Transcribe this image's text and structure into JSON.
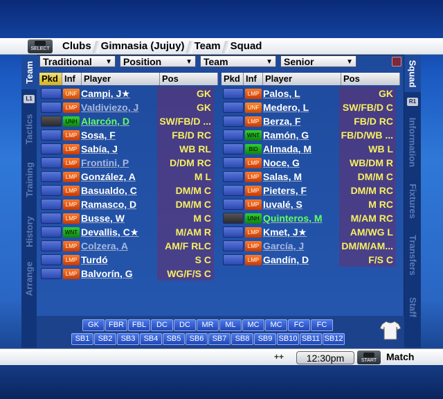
{
  "breadcrumb": {
    "select_label": "SELECT",
    "items": [
      "Clubs",
      "Gimnasia (Jujuy)",
      "Team",
      "Squad"
    ]
  },
  "left_tabs": [
    {
      "label": "Team",
      "active": true
    },
    {
      "label": "Tactics",
      "active": false
    },
    {
      "label": "Training",
      "active": false
    },
    {
      "label": "History",
      "active": false
    },
    {
      "label": "Arrange",
      "active": false
    }
  ],
  "left_tag": "L1",
  "right_tabs": [
    {
      "label": "Squad",
      "active": true
    },
    {
      "label": "Information",
      "active": false
    },
    {
      "label": "Fixtures",
      "active": false
    },
    {
      "label": "Transfers",
      "active": false
    },
    {
      "label": "Staff",
      "active": false
    }
  ],
  "right_tag": "R1",
  "filters": [
    "Traditional",
    "Position",
    "Team",
    "Senior"
  ],
  "columns": {
    "pkd": "Pkd",
    "inf": "Inf",
    "player": "Player",
    "pos": "Pos"
  },
  "left_players": [
    {
      "inf": "UNF",
      "name": "Campi, J★",
      "pos": "GK",
      "style": "normal",
      "pk": "blue"
    },
    {
      "inf": "LMP",
      "name": "Valdiviezo, J",
      "pos": "GK",
      "style": "muted",
      "pk": "blue"
    },
    {
      "inf": "UNH",
      "name": "Alarcón, D",
      "pos": "SW/FB/D ...",
      "style": "green",
      "pk": "dark"
    },
    {
      "inf": "LMP",
      "name": "Sosa, F",
      "pos": "FB/D RC",
      "style": "normal",
      "pk": "blue"
    },
    {
      "inf": "LMP",
      "name": "Sabía, J",
      "pos": "WB RL",
      "style": "normal",
      "pk": "blue"
    },
    {
      "inf": "LMP",
      "name": "Frontini, P",
      "pos": "D/DM RC",
      "style": "muted",
      "pk": "blue"
    },
    {
      "inf": "LMP",
      "name": "González, A",
      "pos": "M L",
      "style": "normal",
      "pk": "blue"
    },
    {
      "inf": "LMP",
      "name": "Basualdo, C",
      "pos": "DM/M C",
      "style": "normal",
      "pk": "blue"
    },
    {
      "inf": "LMP",
      "name": "Ramasco, D",
      "pos": "DM/M C",
      "style": "normal",
      "pk": "blue"
    },
    {
      "inf": "LMP",
      "name": "Busse, W",
      "pos": "M C",
      "style": "normal",
      "pk": "blue"
    },
    {
      "inf": "WNT",
      "name": "Devallis, C★",
      "pos": "M/AM R",
      "style": "normal",
      "pk": "blue"
    },
    {
      "inf": "LMP",
      "name": "Colzera, A",
      "pos": "AM/F RLC",
      "style": "muted",
      "pk": "blue"
    },
    {
      "inf": "LMP",
      "name": "Turdó",
      "pos": "S C",
      "style": "normal",
      "pk": "blue"
    },
    {
      "inf": "LMP",
      "name": "Balvorín, G",
      "pos": "WG/F/S C",
      "style": "normal",
      "pk": "blue"
    }
  ],
  "right_players": [
    {
      "inf": "LMP",
      "name": "Palos, L",
      "pos": "GK",
      "style": "normal",
      "pk": "blue"
    },
    {
      "inf": "UNF",
      "name": "Medero, L",
      "pos": "SW/FB/D C",
      "style": "normal",
      "pk": "blue"
    },
    {
      "inf": "LMP",
      "name": "Berza, F",
      "pos": "FB/D RC",
      "style": "normal",
      "pk": "blue"
    },
    {
      "inf": "WNT",
      "name": "Ramón, G",
      "pos": "FB/D/WB ...",
      "style": "normal",
      "pk": "blue"
    },
    {
      "inf": "BID",
      "name": "Almada, M",
      "pos": "WB L",
      "style": "normal",
      "pk": "blue"
    },
    {
      "inf": "LMP",
      "name": "Noce, G",
      "pos": "WB/DM R",
      "style": "normal",
      "pk": "blue"
    },
    {
      "inf": "LMP",
      "name": "Salas, M",
      "pos": "DM/M C",
      "style": "normal",
      "pk": "blue"
    },
    {
      "inf": "LMP",
      "name": "Pieters, F",
      "pos": "DM/M RC",
      "style": "normal",
      "pk": "blue"
    },
    {
      "inf": "LMP",
      "name": "Iuvalé, S",
      "pos": "M RC",
      "style": "normal",
      "pk": "blue"
    },
    {
      "inf": "UNH",
      "name": "Quinteros, M",
      "pos": "M/AM RC",
      "style": "green",
      "pk": "dark"
    },
    {
      "inf": "LMP",
      "name": "Kmet, J★",
      "pos": "AM/WG L",
      "style": "normal",
      "pk": "blue"
    },
    {
      "inf": "LMP",
      "name": "García, J",
      "pos": "DM/M/AM...",
      "style": "muted",
      "pk": "blue"
    },
    {
      "inf": "LMP",
      "name": "Gandín, D",
      "pos": "F/S C",
      "style": "normal",
      "pk": "blue"
    }
  ],
  "position_buttons": [
    "GK",
    "FBR",
    "FBL",
    "DC",
    "DC",
    "MR",
    "ML",
    "MC",
    "MC",
    "FC",
    "FC"
  ],
  "sub_buttons": [
    "SB1",
    "SB2",
    "SB3",
    "SB4",
    "SB5",
    "SB6",
    "SB7",
    "SB8",
    "SB9",
    "SB10",
    "SB11",
    "SB12"
  ],
  "bottom": {
    "arrows": "++",
    "clock": "12:30pm",
    "start_label": "START",
    "match_label": "Match"
  },
  "colors": {
    "position_text": "#f8f060",
    "name_green": "#60ff60",
    "pkd_header": "#e8c840"
  }
}
